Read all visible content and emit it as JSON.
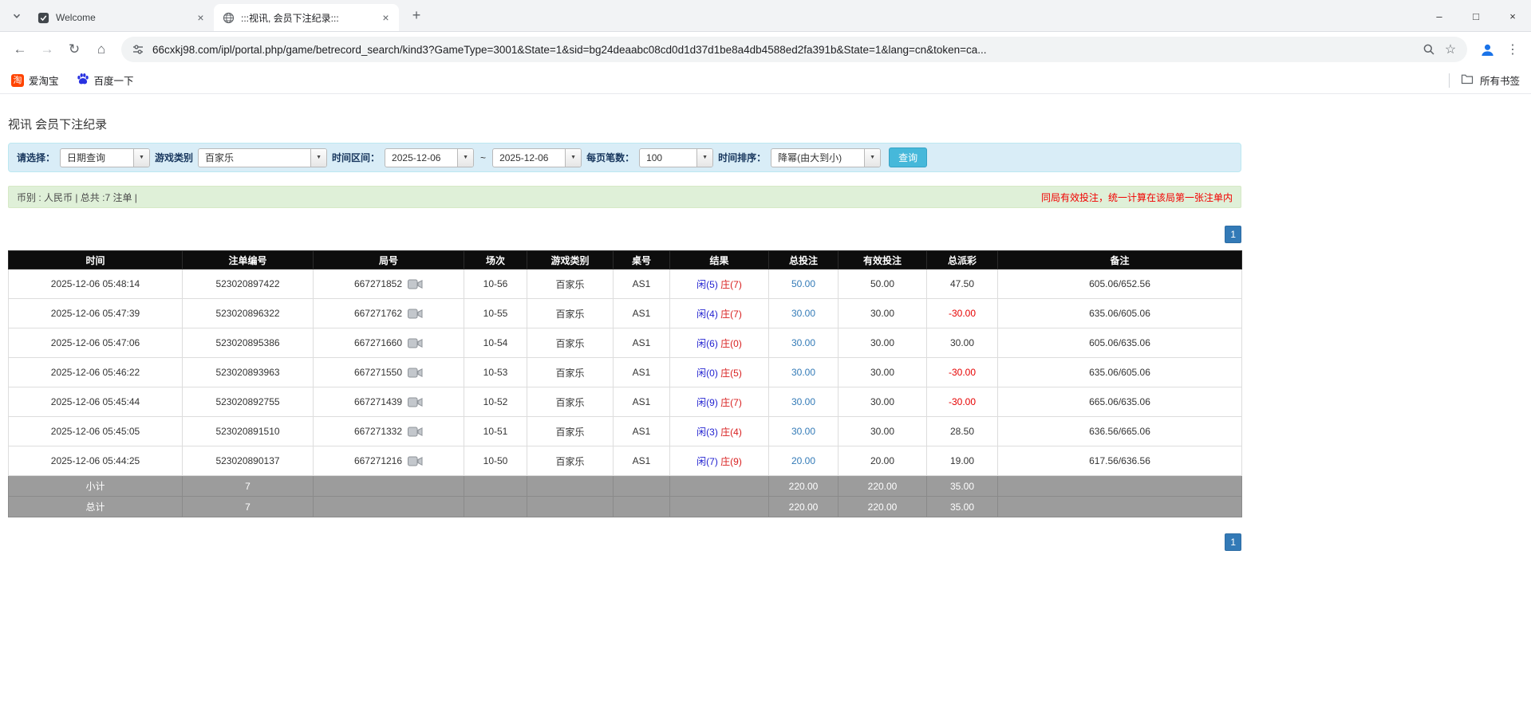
{
  "browser": {
    "tabs": [
      {
        "title": "Welcome"
      },
      {
        "title": ":::视讯, 会员下注纪录:::"
      }
    ],
    "url": "66cxkj98.com/ipl/portal.php/game/betrecord_search/kind3?GameType=3001&State=1&sid=bg24deaabc08cd0d1d37d1be8a4db4588ed2fa391b&State=1&lang=cn&token=ca...",
    "bookmarks": [
      {
        "label": "爱淘宝"
      },
      {
        "label": "百度一下"
      }
    ],
    "all_bookmarks_label": "所有书签"
  },
  "icons": {
    "close_glyph": "×",
    "plus_glyph": "+",
    "minimize_glyph": "–",
    "maximize_glyph": "□",
    "back_glyph": "←",
    "forward_glyph": "→",
    "refresh_glyph": "↻",
    "home_glyph": "⌂",
    "menu_glyph": "⋮",
    "star_glyph": "☆",
    "dropdown_glyph": "▼",
    "taobao_glyph": "淘"
  },
  "page": {
    "title": "视讯 会员下注纪录",
    "filters": {
      "select_label": "请选择：",
      "select_value": "日期查询",
      "game_type_label": "游戏类别",
      "game_type_value": "百家乐",
      "date_range_label": "时间区间：",
      "date_from": "2025-12-06",
      "date_separator": "~",
      "date_to": "2025-12-06",
      "page_size_label": "每页笔数：",
      "page_size_value": "100",
      "sort_label": "时间排序：",
      "sort_value": "降幂(由大到小)",
      "search_button_label": "查询"
    },
    "summary": {
      "info": "币别 : 人民币 | 总共 :7 注单 |",
      "note": "同局有效投注，统一计算在该局第一张注单内"
    },
    "pagination": {
      "current_page": "1"
    },
    "table": {
      "headers": [
        "时间",
        "注单编号",
        "局号",
        "场次",
        "游戏类别",
        "桌号",
        "结果",
        "总投注",
        "有效投注",
        "总派彩",
        "备注"
      ],
      "rows": [
        {
          "time": "2025-12-06 05:48:14",
          "bet_id": "523020897422",
          "round": "667271852",
          "session": "10-56",
          "game": "百家乐",
          "table": "AS1",
          "result_player": "闲(5)",
          "result_banker": "庄(7)",
          "total_bet": "50.00",
          "valid_bet": "50.00",
          "payout": "47.50",
          "note": "605.06/652.56"
        },
        {
          "time": "2025-12-06 05:47:39",
          "bet_id": "523020896322",
          "round": "667271762",
          "session": "10-55",
          "game": "百家乐",
          "table": "AS1",
          "result_player": "闲(4)",
          "result_banker": "庄(7)",
          "total_bet": "30.00",
          "valid_bet": "30.00",
          "payout": "-30.00",
          "note": "635.06/605.06"
        },
        {
          "time": "2025-12-06 05:47:06",
          "bet_id": "523020895386",
          "round": "667271660",
          "session": "10-54",
          "game": "百家乐",
          "table": "AS1",
          "result_player": "闲(6)",
          "result_banker": "庄(0)",
          "total_bet": "30.00",
          "valid_bet": "30.00",
          "payout": "30.00",
          "note": "605.06/635.06"
        },
        {
          "time": "2025-12-06 05:46:22",
          "bet_id": "523020893963",
          "round": "667271550",
          "session": "10-53",
          "game": "百家乐",
          "table": "AS1",
          "result_player": "闲(0)",
          "result_banker": "庄(5)",
          "total_bet": "30.00",
          "valid_bet": "30.00",
          "payout": "-30.00",
          "note": "635.06/605.06"
        },
        {
          "time": "2025-12-06 05:45:44",
          "bet_id": "523020892755",
          "round": "667271439",
          "session": "10-52",
          "game": "百家乐",
          "table": "AS1",
          "result_player": "闲(9)",
          "result_banker": "庄(7)",
          "total_bet": "30.00",
          "valid_bet": "30.00",
          "payout": "-30.00",
          "note": "665.06/635.06"
        },
        {
          "time": "2025-12-06 05:45:05",
          "bet_id": "523020891510",
          "round": "667271332",
          "session": "10-51",
          "game": "百家乐",
          "table": "AS1",
          "result_player": "闲(3)",
          "result_banker": "庄(4)",
          "total_bet": "30.00",
          "valid_bet": "30.00",
          "payout": "28.50",
          "note": "636.56/665.06"
        },
        {
          "time": "2025-12-06 05:44:25",
          "bet_id": "523020890137",
          "round": "667271216",
          "session": "10-50",
          "game": "百家乐",
          "table": "AS1",
          "result_player": "闲(7)",
          "result_banker": "庄(9)",
          "total_bet": "20.00",
          "valid_bet": "20.00",
          "payout": "19.00",
          "note": "617.56/636.56"
        }
      ],
      "subtotal": {
        "label": "小计",
        "count": "7",
        "total_bet": "220.00",
        "valid_bet": "220.00",
        "payout": "35.00"
      },
      "total": {
        "label": "总计",
        "count": "7",
        "total_bet": "220.00",
        "valid_bet": "220.00",
        "payout": "35.00"
      }
    },
    "colors": {
      "accent_blue": "#337ab7",
      "negative_red": "#e60000",
      "player_blue": "#1f1fd0",
      "banker_red": "#d81e1e",
      "search_button": "#46b8da",
      "filter_bg": "#d9edf7",
      "summary_bg": "#dff0d8",
      "header_bg": "#0d0d0d",
      "footer_bg": "#9c9c9c"
    }
  }
}
